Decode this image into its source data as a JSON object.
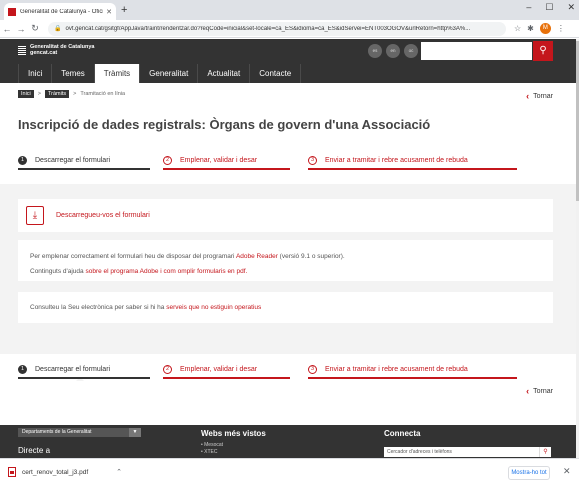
{
  "browser": {
    "tab_title": "Generalitat de Catalunya - Oficin",
    "url": "ovt.gencat.cat/gsitgf/AppJava/traint/renderitzar.do?reqCode=inicial&set-locale=ca_ES&idioma=ca_ES&idServei=ENT003OGOV&urlRetorn=http%3A%...",
    "profile_letter": "M"
  },
  "site": {
    "logo_line1": "Generalitat de Catalunya",
    "logo_line2": "gencat.cat",
    "languages": [
      "es",
      "en",
      "oc"
    ]
  },
  "nav": {
    "items": [
      "Inici",
      "Temes",
      "Tràmits",
      "Generalitat",
      "Actualitat",
      "Contacte"
    ],
    "active": "Tràmits"
  },
  "breadcrumb": {
    "items": [
      "Inici",
      "Tràmits",
      "Tramitació en línia"
    ]
  },
  "tornar_label": "Tornar",
  "page_title": "Inscripció de dades registrals: Òrgans de govern d'una Associació",
  "steps": [
    {
      "num": "1",
      "label": "Descarregar el formulari"
    },
    {
      "num": "2",
      "label": "Emplenar, validar i desar"
    },
    {
      "num": "3",
      "label": "Enviar a tramitar i rebre acusament de rebuda"
    }
  ],
  "download": {
    "link": "Descarregueu-vos el formulari"
  },
  "info": {
    "line1_pre": "Per emplenar correctament el formulari heu de disposar del programari",
    "line1_link": "Adobe Reader",
    "line1_post": "(versió 9.1 o superior).",
    "line2_pre": "Continguts d'ajuda",
    "line2_link": "sobre el programa Adobe i com omplir formularis en pdf."
  },
  "status": {
    "pre": "Consulteu la Seu electrònica per saber si hi ha",
    "link": "serveis que no estiguin operatius"
  },
  "footer": {
    "dept_select": "Departaments de la Generalitat",
    "directe": "Directe a",
    "webs_title": "Webs més vistos",
    "webs_items": [
      "Mesocat",
      "XTEC"
    ],
    "connecta_title": "Connecta",
    "phone_search_placeholder": "Cercador d'adreces i telèfons"
  },
  "download_bar": {
    "filename": "cert_renov_total_j3.pdf",
    "show_all": "Mostra-ho tot"
  },
  "colors": {
    "accent": "#c4161c",
    "header_bg": "#333333",
    "grey_bg": "#f3f3f3"
  }
}
